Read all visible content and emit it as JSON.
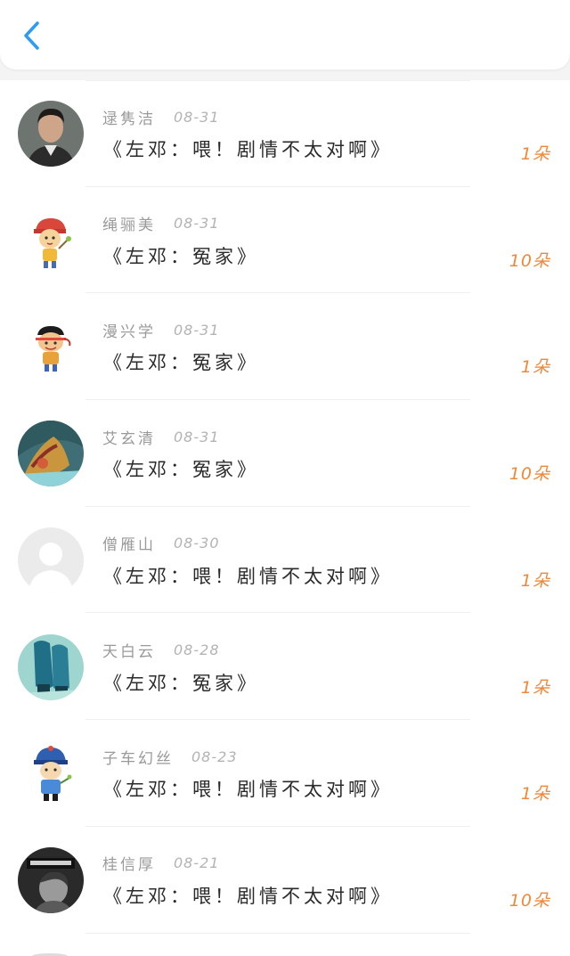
{
  "header": {
    "back_icon": "chevron-left-icon",
    "accent_color": "#2d9cf0"
  },
  "gift_color": "#f0883a",
  "records": [
    {
      "name": "逯隽洁",
      "date": "08-31",
      "title": "《左邓：喂！剧情不太对啊》",
      "amount": "1朵",
      "avatar": "man-portrait"
    },
    {
      "name": "绳骊美",
      "date": "08-31",
      "title": "《左邓：冤家》",
      "amount": "10朵",
      "avatar": "cartoon-kid-cap"
    },
    {
      "name": "漫兴学",
      "date": "08-31",
      "title": "《左邓：冤家》",
      "amount": "1朵",
      "avatar": "cartoon-boy"
    },
    {
      "name": "艾玄清",
      "date": "08-31",
      "title": "《左邓：冤家》",
      "amount": "10朵",
      "avatar": "colorful-photo"
    },
    {
      "name": "僧雁山",
      "date": "08-30",
      "title": "《左邓：喂！剧情不太对啊》",
      "amount": "1朵",
      "avatar": "default-person"
    },
    {
      "name": "天白云",
      "date": "08-28",
      "title": "《左邓：冤家》",
      "amount": "1朵",
      "avatar": "teal-photo"
    },
    {
      "name": "子车幻丝",
      "date": "08-23",
      "title": "《左邓：喂！剧情不太对啊》",
      "amount": "1朵",
      "avatar": "cartoon-official"
    },
    {
      "name": "桂信厚",
      "date": "08-21",
      "title": "《左邓：喂！剧情不太对啊》",
      "amount": "10朵",
      "avatar": "bw-portrait"
    }
  ]
}
